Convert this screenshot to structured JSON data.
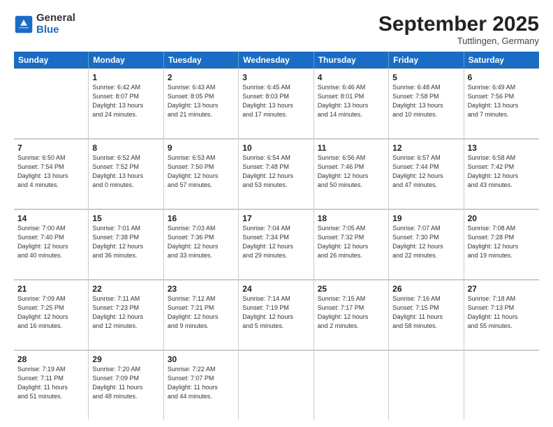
{
  "logo": {
    "general": "General",
    "blue": "Blue"
  },
  "title": "September 2025",
  "location": "Tuttlingen, Germany",
  "days": [
    "Sunday",
    "Monday",
    "Tuesday",
    "Wednesday",
    "Thursday",
    "Friday",
    "Saturday"
  ],
  "rows": [
    [
      {
        "day": "",
        "info": ""
      },
      {
        "day": "1",
        "info": "Sunrise: 6:42 AM\nSunset: 8:07 PM\nDaylight: 13 hours\nand 24 minutes."
      },
      {
        "day": "2",
        "info": "Sunrise: 6:43 AM\nSunset: 8:05 PM\nDaylight: 13 hours\nand 21 minutes."
      },
      {
        "day": "3",
        "info": "Sunrise: 6:45 AM\nSunset: 8:03 PM\nDaylight: 13 hours\nand 17 minutes."
      },
      {
        "day": "4",
        "info": "Sunrise: 6:46 AM\nSunset: 8:01 PM\nDaylight: 13 hours\nand 14 minutes."
      },
      {
        "day": "5",
        "info": "Sunrise: 6:48 AM\nSunset: 7:58 PM\nDaylight: 13 hours\nand 10 minutes."
      },
      {
        "day": "6",
        "info": "Sunrise: 6:49 AM\nSunset: 7:56 PM\nDaylight: 13 hours\nand 7 minutes."
      }
    ],
    [
      {
        "day": "7",
        "info": "Sunrise: 6:50 AM\nSunset: 7:54 PM\nDaylight: 13 hours\nand 4 minutes."
      },
      {
        "day": "8",
        "info": "Sunrise: 6:52 AM\nSunset: 7:52 PM\nDaylight: 13 hours\nand 0 minutes."
      },
      {
        "day": "9",
        "info": "Sunrise: 6:53 AM\nSunset: 7:50 PM\nDaylight: 12 hours\nand 57 minutes."
      },
      {
        "day": "10",
        "info": "Sunrise: 6:54 AM\nSunset: 7:48 PM\nDaylight: 12 hours\nand 53 minutes."
      },
      {
        "day": "11",
        "info": "Sunrise: 6:56 AM\nSunset: 7:46 PM\nDaylight: 12 hours\nand 50 minutes."
      },
      {
        "day": "12",
        "info": "Sunrise: 6:57 AM\nSunset: 7:44 PM\nDaylight: 12 hours\nand 47 minutes."
      },
      {
        "day": "13",
        "info": "Sunrise: 6:58 AM\nSunset: 7:42 PM\nDaylight: 12 hours\nand 43 minutes."
      }
    ],
    [
      {
        "day": "14",
        "info": "Sunrise: 7:00 AM\nSunset: 7:40 PM\nDaylight: 12 hours\nand 40 minutes."
      },
      {
        "day": "15",
        "info": "Sunrise: 7:01 AM\nSunset: 7:38 PM\nDaylight: 12 hours\nand 36 minutes."
      },
      {
        "day": "16",
        "info": "Sunrise: 7:03 AM\nSunset: 7:36 PM\nDaylight: 12 hours\nand 33 minutes."
      },
      {
        "day": "17",
        "info": "Sunrise: 7:04 AM\nSunset: 7:34 PM\nDaylight: 12 hours\nand 29 minutes."
      },
      {
        "day": "18",
        "info": "Sunrise: 7:05 AM\nSunset: 7:32 PM\nDaylight: 12 hours\nand 26 minutes."
      },
      {
        "day": "19",
        "info": "Sunrise: 7:07 AM\nSunset: 7:30 PM\nDaylight: 12 hours\nand 22 minutes."
      },
      {
        "day": "20",
        "info": "Sunrise: 7:08 AM\nSunset: 7:28 PM\nDaylight: 12 hours\nand 19 minutes."
      }
    ],
    [
      {
        "day": "21",
        "info": "Sunrise: 7:09 AM\nSunset: 7:25 PM\nDaylight: 12 hours\nand 16 minutes."
      },
      {
        "day": "22",
        "info": "Sunrise: 7:11 AM\nSunset: 7:23 PM\nDaylight: 12 hours\nand 12 minutes."
      },
      {
        "day": "23",
        "info": "Sunrise: 7:12 AM\nSunset: 7:21 PM\nDaylight: 12 hours\nand 9 minutes."
      },
      {
        "day": "24",
        "info": "Sunrise: 7:14 AM\nSunset: 7:19 PM\nDaylight: 12 hours\nand 5 minutes."
      },
      {
        "day": "25",
        "info": "Sunrise: 7:15 AM\nSunset: 7:17 PM\nDaylight: 12 hours\nand 2 minutes."
      },
      {
        "day": "26",
        "info": "Sunrise: 7:16 AM\nSunset: 7:15 PM\nDaylight: 11 hours\nand 58 minutes."
      },
      {
        "day": "27",
        "info": "Sunrise: 7:18 AM\nSunset: 7:13 PM\nDaylight: 11 hours\nand 55 minutes."
      }
    ],
    [
      {
        "day": "28",
        "info": "Sunrise: 7:19 AM\nSunset: 7:11 PM\nDaylight: 11 hours\nand 51 minutes."
      },
      {
        "day": "29",
        "info": "Sunrise: 7:20 AM\nSunset: 7:09 PM\nDaylight: 11 hours\nand 48 minutes."
      },
      {
        "day": "30",
        "info": "Sunrise: 7:22 AM\nSunset: 7:07 PM\nDaylight: 11 hours\nand 44 minutes."
      },
      {
        "day": "",
        "info": ""
      },
      {
        "day": "",
        "info": ""
      },
      {
        "day": "",
        "info": ""
      },
      {
        "day": "",
        "info": ""
      }
    ]
  ]
}
